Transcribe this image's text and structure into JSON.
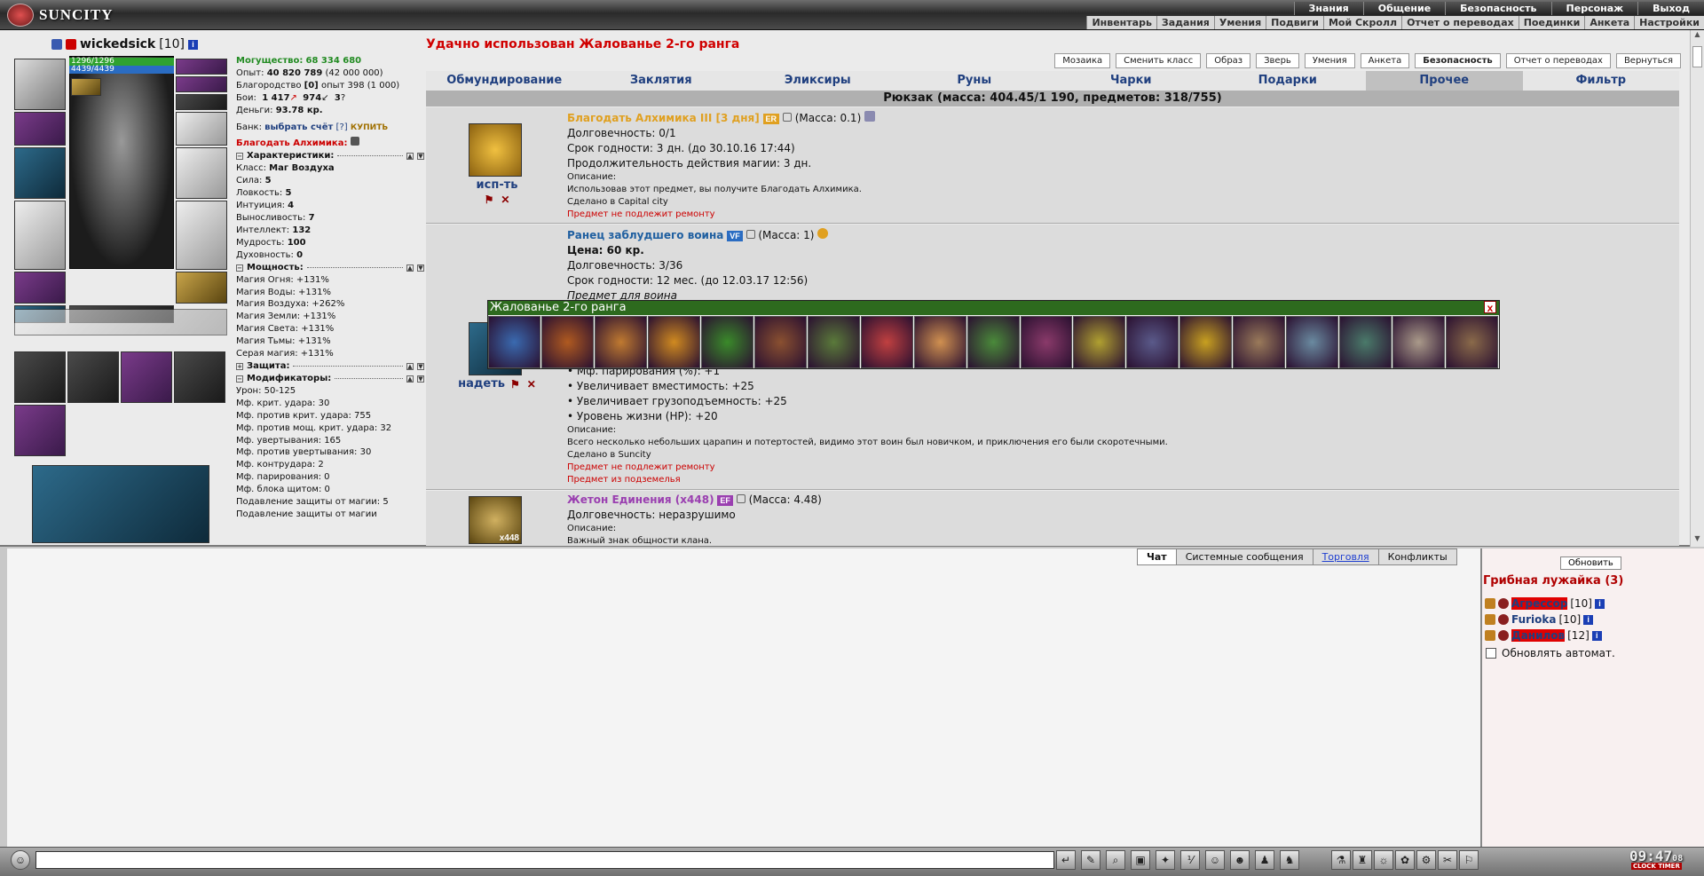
{
  "app": {
    "logo_text": "SUNCITY"
  },
  "top_menu": [
    "Знания",
    "Общение",
    "Безопасность",
    "Персонаж",
    "Выход"
  ],
  "sub_menu": [
    "Инвентарь",
    "Задания",
    "Умения",
    "Подвиги",
    "Мой Скролл",
    "Отчет о переводах",
    "Поединки",
    "Анкета",
    "Настройки"
  ],
  "character": {
    "nick": "wickedsick",
    "level": "[10]",
    "hp": "1296/1296",
    "mp": "4439/4439",
    "might_label": "Могущество:",
    "might": "68 334 680",
    "exp_label": "Опыт:",
    "exp": "40 820 789",
    "exp_next": "(42 000 000)",
    "nobility_label": "Благородство",
    "nobility": "[0]",
    "nobility_exp": "опыт 398 (1 000)",
    "fights_label": "Бои:",
    "wins": "1 417",
    "losses": "974",
    "draws": "3",
    "money_label": "Деньги:",
    "money": "93.78 кр.",
    "bank_label": "Банк:",
    "bank_link": "выбрать счёт",
    "bank_help": "[?]",
    "buy": "КУПИТЬ",
    "blessing": "Благодать Алхимика:"
  },
  "characteristics": {
    "title": "Характеристики:",
    "rows": [
      {
        "label": "Класс:",
        "value": "Маг Воздуха"
      },
      {
        "label": "Сила:",
        "value": "5"
      },
      {
        "label": "Ловкость:",
        "value": "5"
      },
      {
        "label": "Интуиция:",
        "value": "4"
      },
      {
        "label": "Выносливость:",
        "value": "7"
      },
      {
        "label": "Интеллект:",
        "value": "132"
      },
      {
        "label": "Мудрость:",
        "value": "100"
      },
      {
        "label": "Духовность:",
        "value": "0"
      }
    ]
  },
  "power": {
    "title": "Мощность:",
    "rows": [
      "Магия Огня: +131%",
      "Магия Воды: +131%",
      "Магия Воздуха: +262%",
      "Магия Земли: +131%",
      "Магия Света: +131%",
      "Магия Тьмы: +131%",
      "Серая магия: +131%"
    ]
  },
  "defense": {
    "title": "Защита:"
  },
  "modifiers": {
    "title": "Модификаторы:",
    "rows": [
      "Урон: 50-125",
      "Мф. крит. удара: 30",
      "Мф. против крит. удара: 755",
      "Мф. против мощ. крит. удара: 32",
      "Мф. увертывания: 165",
      "Мф. против увертывания: 30",
      "Мф. контрудара: 2",
      "Мф. парирования: 0",
      "Мф. блока щитом: 0",
      "Подавление защиты от магии: 5",
      "Подавление защиты от магии"
    ]
  },
  "status_message": "Удачно использован Жалованье 2-го ранга",
  "buttons": [
    "Мозаика",
    "Сменить класс",
    "Образ",
    "Зверь",
    "Умения",
    "Анкета",
    "Безопасность",
    "Отчет о переводах",
    "Вернуться"
  ],
  "tabs": [
    "Обмундирование",
    "Заклятия",
    "Эликсиры",
    "Руны",
    "Чарки",
    "Подарки",
    "Прочее",
    "Фильтр"
  ],
  "active_tab": "Прочее",
  "bag_title": "Рюкзак (масса: 404.45/1 190, предметов: 318/755)",
  "items": [
    {
      "name": "Благодать Алхимика III [3 дня]",
      "tag": "ER",
      "mass": "(Масса: 0.1)",
      "action": "исп-ть",
      "lines": [
        "Долговечность: 0/1",
        "Срок годности: 3 дн. (до 30.10.16 17:44)",
        "Продолжительность действия магии: 3 дн."
      ],
      "small": [
        "Описание:",
        "Использовав этот предмет, вы получите Благодать Алхимика.",
        "Сделано в Capital city"
      ],
      "red": [
        "Предмет не подлежит ремонту"
      ]
    },
    {
      "name": "Ранец заблудшего воина",
      "tag": "VF",
      "mass": "(Масса: 1)",
      "action": "надеть",
      "price": "Цена: 60 кр.",
      "lines": [
        "Долговечность: 3/36",
        "Срок годности: 12 мес. (до 12.03.17 12:56)",
        "Предмет для воина"
      ],
      "props": [
        "• Мф. парирования (%): +1",
        "• Увеличивает вместимость: +25",
        "• Увеличивает грузоподъемность: +25",
        "• Уровень жизни (HP): +20"
      ],
      "small": [
        "Описание:",
        "Всего несколько небольших царапин и потертостей, видимо этот воин был новичком, и приключения его были скоротечными.",
        "Сделано в Suncity"
      ],
      "red": [
        "Предмет не подлежит ремонту",
        "Предмет из подземелья"
      ]
    },
    {
      "name": "Жетон Единения (x448)",
      "tag": "EF",
      "mass": "(Масса: 4.48)",
      "count": "x448",
      "lines": [
        "Долговечность: неразрушимо"
      ],
      "small": [
        "Описание:",
        "Важный знак общности клана."
      ]
    }
  ],
  "popup": {
    "title": "Жалованье 2-го ранга",
    "close": "x",
    "cells": [
      "#3a6ab0",
      "#b05a20",
      "#c07a30",
      "#d08a20",
      "#3a8a2a",
      "#8a5030",
      "#5a7a3a",
      "#c04040",
      "#d09050",
      "#4a8a3a",
      "#8a3a6a",
      "#b0a030",
      "#5a5a8a",
      "#c8a020",
      "#9a7a5a",
      "#6a8aa0",
      "#4a7a6a",
      "#aa9a8a",
      "#8a6a4a"
    ]
  },
  "chat_tabs": [
    "Чат",
    "Системные сообщения",
    "Торговля",
    "Конфликты"
  ],
  "right_panel": {
    "refresh": "Обновить",
    "location": "Грибная лужайка (3)",
    "players": [
      {
        "name": "Агрессор",
        "level": "[10]",
        "highlight": true
      },
      {
        "name": "Furioka",
        "level": "[10]",
        "highlight": false
      },
      {
        "name": "Данилов",
        "level": "[12]",
        "highlight": true
      }
    ],
    "autorefresh": "Обновлять автомат."
  },
  "clock": {
    "time": "09:47",
    "seconds": "08",
    "label1": "CLOCK",
    "label2": "TIMER"
  }
}
